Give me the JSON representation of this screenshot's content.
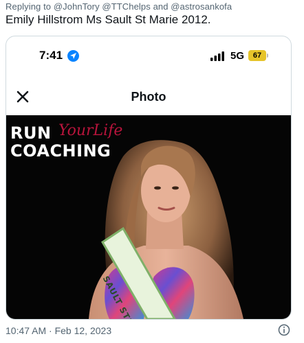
{
  "tweet": {
    "reply_line": "Replying to @JohnTory @TTChelps and @astrosankofa",
    "text": "Emily Hillstrom Ms Sault St Marie 2012.",
    "timestamp": "10:47 AM · Feb 12, 2023"
  },
  "phone_status": {
    "time": "7:41",
    "network": "5G",
    "battery": "67",
    "icons": [
      "location-arrow-icon",
      "signal-bars-icon",
      "battery-icon"
    ]
  },
  "photo_viewer": {
    "title": "Photo",
    "close_icon": "close-icon"
  },
  "photo": {
    "logo_line1": "RUN",
    "logo_script": "YourLife",
    "logo_line2": "COACHING",
    "sash_text": "SAULT STE"
  },
  "colors": {
    "accent_blue": "#0a84ff",
    "battery_yellow": "#e6c42a",
    "logo_script_red": "#b8143c",
    "secondary_text": "#536471"
  }
}
